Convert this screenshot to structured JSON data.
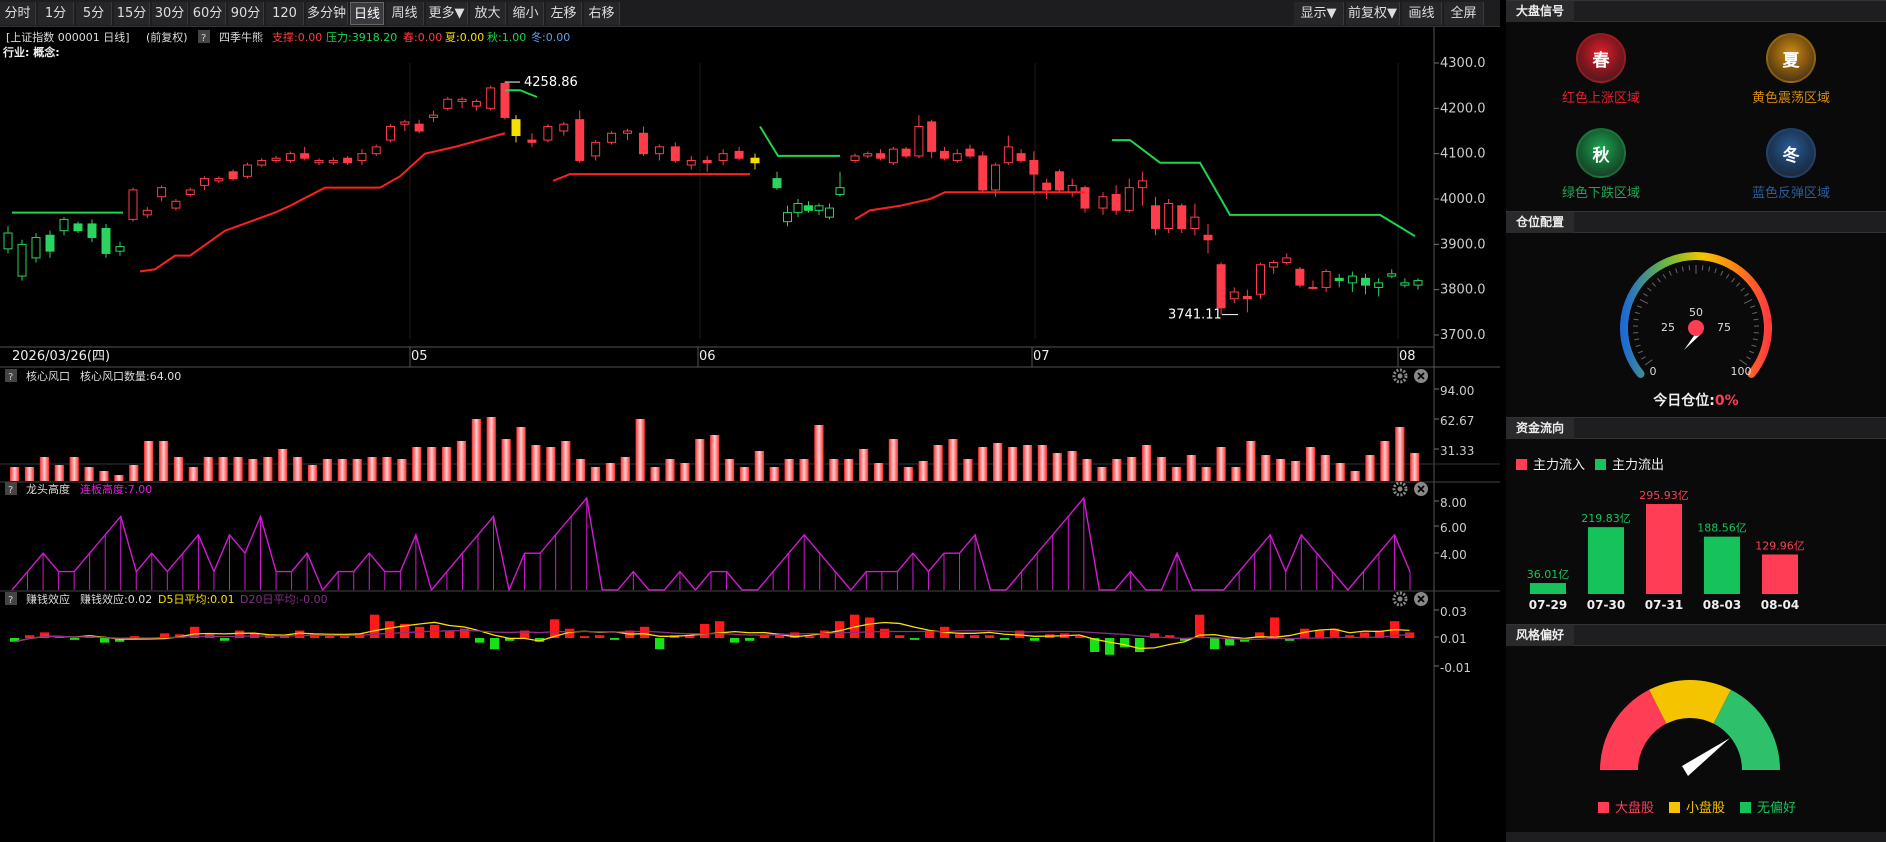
{
  "toolbar": {
    "periods": [
      "分时",
      "1分",
      "5分",
      "15分",
      "30分",
      "60分",
      "90分",
      "120分",
      "多分钟",
      "日线",
      "周线",
      "更多▼",
      "放大",
      "缩小",
      "左移",
      "右移"
    ],
    "active": "日线",
    "right_buttons": [
      "显示▼",
      "前复权▼",
      "画线",
      "全屏"
    ]
  },
  "header": {
    "title": "[上证指数 000001 日线]",
    "adjust": "(前复权)",
    "help": "?",
    "indicator": "四季牛熊",
    "support": "支撑:0.00",
    "pressure": "压力:3918.20",
    "spring": "春:0.00",
    "summer": "夏:0.00",
    "autumn": "秋:1.00",
    "winter": "冬:0.00",
    "sector": "行业: 概念:"
  },
  "main_axis": {
    "labels": [
      "4300.0",
      "4200.0",
      "4100.0",
      "4000.0",
      "3900.0",
      "3800.0",
      "3700.0"
    ]
  },
  "main_annot": {
    "high": "4258.86",
    "low": "3741.11"
  },
  "date_axis": {
    "start": "2026/03/26(四)",
    "months": [
      "05",
      "06",
      "07",
      "08"
    ]
  },
  "panels": {
    "p1": {
      "title": "核心风口",
      "value": "核心风口数量:64.00",
      "axis": [
        "94.00",
        "62.67",
        "31.33"
      ]
    },
    "p2": {
      "title": "龙头高度",
      "value": "连板高度:7.00",
      "axis": [
        "8.00",
        "6.00",
        "4.00"
      ]
    },
    "p3": {
      "title": "赚钱效应",
      "value": "赚钱效应:0.02",
      "d5": "D5日平均:0.01",
      "d20": "D20日平均:-0.00",
      "axis": [
        "0.03",
        "0.01",
        "-0.01"
      ]
    }
  },
  "chart_data": [
    {
      "type": "candlestick",
      "ylim": [
        3700,
        4300
      ],
      "high_label": 4258.86,
      "low_label": 3741.11,
      "candles": [
        [
          3890,
          3925,
          3880,
          3940
        ],
        [
          3830,
          3900,
          3820,
          3910
        ],
        [
          3870,
          3915,
          3860,
          3925
        ],
        [
          3920,
          3885,
          3870,
          3930
        ],
        [
          3930,
          3955,
          3920,
          3960
        ],
        [
          3945,
          3930,
          3925,
          3950
        ],
        [
          3945,
          3915,
          3905,
          3955
        ],
        [
          3935,
          3880,
          3870,
          3945
        ],
        [
          3885,
          3895,
          3875,
          3905
        ],
        [
          3955,
          4020,
          3950,
          4025
        ],
        [
          3965,
          3975,
          3958,
          3982
        ],
        [
          4005,
          4025,
          3995,
          4030
        ],
        [
          3980,
          3995,
          3975,
          4000
        ],
        [
          4010,
          4020,
          4005,
          4025
        ],
        [
          4030,
          4045,
          4020,
          4050
        ],
        [
          4040,
          4045,
          4035,
          4050
        ],
        [
          4060,
          4045,
          4040,
          4065
        ],
        [
          4050,
          4075,
          4045,
          4080
        ],
        [
          4075,
          4085,
          4070,
          4090
        ],
        [
          4085,
          4090,
          4080,
          4095
        ],
        [
          4085,
          4100,
          4080,
          4105
        ],
        [
          4100,
          4090,
          4085,
          4115
        ],
        [
          4080,
          4085,
          4075,
          4090
        ],
        [
          4080,
          4085,
          4075,
          4092
        ],
        [
          4090,
          4080,
          4075,
          4095
        ],
        [
          4085,
          4100,
          4075,
          4110
        ],
        [
          4100,
          4115,
          4095,
          4120
        ],
        [
          4130,
          4160,
          4125,
          4165
        ],
        [
          4165,
          4170,
          4150,
          4175
        ],
        [
          4165,
          4150,
          4145,
          4175
        ],
        [
          4180,
          4185,
          4170,
          4195
        ],
        [
          4200,
          4220,
          4195,
          4225
        ],
        [
          4215,
          4220,
          4200,
          4225
        ],
        [
          4205,
          4215,
          4195,
          4220
        ],
        [
          4200,
          4245,
          4195,
          4250
        ],
        [
          4255,
          4180,
          4175,
          4259
        ],
        [
          4175,
          4140,
          4125,
          4185
        ],
        [
          4130,
          4125,
          4115,
          4145
        ],
        [
          4130,
          4160,
          4125,
          4165
        ],
        [
          4150,
          4165,
          4140,
          4170
        ],
        [
          4175,
          4085,
          4080,
          4195
        ],
        [
          4095,
          4125,
          4085,
          4130
        ],
        [
          4125,
          4145,
          4120,
          4150
        ],
        [
          4145,
          4150,
          4130,
          4155
        ],
        [
          4145,
          4100,
          4095,
          4160
        ],
        [
          4100,
          4115,
          4085,
          4120
        ],
        [
          4115,
          4085,
          4080,
          4125
        ],
        [
          4075,
          4085,
          4065,
          4095
        ],
        [
          4085,
          4080,
          4060,
          4095
        ],
        [
          4085,
          4100,
          4075,
          4110
        ],
        [
          4105,
          4090,
          4085,
          4115
        ],
        [
          4090,
          4080,
          4065,
          4100
        ],
        [
          4045,
          4025,
          4020,
          4060
        ],
        [
          3950,
          3970,
          3940,
          3985
        ],
        [
          3970,
          3990,
          3960,
          4000
        ],
        [
          3985,
          3975,
          3970,
          3995
        ],
        [
          3975,
          3985,
          3965,
          3990
        ],
        [
          3960,
          3980,
          3955,
          3990
        ],
        [
          4010,
          4025,
          4005,
          4060
        ],
        [
          4085,
          4095,
          4080,
          4100
        ],
        [
          4095,
          4100,
          4090,
          4105
        ],
        [
          4100,
          4090,
          4085,
          4110
        ],
        [
          4080,
          4110,
          4075,
          4115
        ],
        [
          4110,
          4095,
          4090,
          4115
        ],
        [
          4095,
          4160,
          4090,
          4185
        ],
        [
          4170,
          4105,
          4090,
          4175
        ],
        [
          4105,
          4090,
          4085,
          4115
        ],
        [
          4085,
          4100,
          4080,
          4110
        ],
        [
          4110,
          4095,
          4090,
          4120
        ],
        [
          4095,
          4020,
          4015,
          4105
        ],
        [
          4020,
          4075,
          4005,
          4080
        ],
        [
          4080,
          4115,
          4075,
          4140
        ],
        [
          4100,
          4085,
          4080,
          4110
        ],
        [
          4085,
          4055,
          4010,
          4105
        ],
        [
          4035,
          4020,
          4000,
          4045
        ],
        [
          4060,
          4020,
          4015,
          4065
        ],
        [
          4015,
          4030,
          4005,
          4045
        ],
        [
          4025,
          3980,
          3970,
          4030
        ],
        [
          3980,
          4005,
          3965,
          4015
        ],
        [
          4010,
          3975,
          3965,
          4030
        ],
        [
          3975,
          4025,
          3970,
          4045
        ],
        [
          4025,
          4040,
          3985,
          4060
        ],
        [
          3985,
          3935,
          3920,
          4005
        ],
        [
          3935,
          3990,
          3925,
          4000
        ],
        [
          3985,
          3935,
          3925,
          3990
        ],
        [
          3935,
          3960,
          3920,
          3990
        ],
        [
          3920,
          3910,
          3880,
          3945
        ],
        [
          3855,
          3760,
          3745,
          3860
        ],
        [
          3780,
          3795,
          3770,
          3805
        ],
        [
          3785,
          3780,
          3750,
          3800
        ],
        [
          3790,
          3855,
          3780,
          3860
        ],
        [
          3850,
          3860,
          3835,
          3865
        ],
        [
          3860,
          3870,
          3855,
          3880
        ],
        [
          3845,
          3810,
          3805,
          3850
        ],
        [
          3805,
          3805,
          3800,
          3820
        ],
        [
          3805,
          3840,
          3795,
          3845
        ],
        [
          3825,
          3820,
          3805,
          3835
        ],
        [
          3815,
          3830,
          3795,
          3840
        ],
        [
          3825,
          3810,
          3790,
          3835
        ],
        [
          3805,
          3815,
          3785,
          3825
        ],
        [
          3830,
          3835,
          3825,
          3845
        ],
        [
          3810,
          3815,
          3805,
          3825
        ],
        [
          3810,
          3820,
          3800,
          3825
        ]
      ]
    },
    {
      "type": "bar",
      "title": "核心风口",
      "ylim": [
        0,
        94
      ],
      "values": [
        14,
        14,
        24,
        16,
        24,
        14,
        10,
        6,
        16,
        40,
        40,
        24,
        14,
        24,
        24,
        24,
        22,
        24,
        32,
        24,
        16,
        22,
        22,
        22,
        24,
        24,
        22,
        34,
        34,
        34,
        40,
        62,
        64,
        42,
        54,
        36,
        34,
        40,
        22,
        14,
        18,
        24,
        62,
        14,
        22,
        18,
        42,
        46,
        22,
        14,
        30,
        14,
        22,
        22,
        56,
        22,
        22,
        32,
        18,
        42,
        14,
        20,
        36,
        42,
        22,
        34,
        38,
        34,
        36,
        36,
        28,
        30,
        22,
        14,
        22,
        24,
        36,
        24,
        14,
        26,
        14,
        34,
        14,
        40,
        26,
        22,
        20,
        34,
        26,
        18,
        10,
        26,
        40,
        54,
        28
      ],
      "total": 64
    },
    {
      "type": "line",
      "title": "龙头高度",
      "ylim": [
        3,
        8
      ],
      "values": [
        3,
        4,
        5,
        4,
        4,
        5,
        6,
        7,
        4,
        5,
        4,
        5,
        6,
        4,
        6,
        5,
        7,
        4,
        4,
        5,
        3,
        4,
        4,
        5,
        4,
        4,
        6,
        3,
        4,
        5,
        6,
        7,
        3,
        5,
        5,
        6,
        7,
        8,
        3,
        3,
        4,
        3,
        3,
        4,
        3,
        4,
        4,
        3,
        3,
        4,
        5,
        6,
        5,
        4,
        3,
        4,
        4,
        4,
        5,
        4,
        5,
        5,
        6,
        3,
        3,
        4,
        5,
        6,
        7,
        8,
        3,
        3,
        4,
        3,
        3,
        5,
        3,
        3,
        3,
        4,
        5,
        6,
        4,
        6,
        5,
        4,
        3,
        4,
        5,
        6,
        4
      ]
    },
    {
      "type": "bar",
      "title": "赚钱效应",
      "ylim": [
        -0.02,
        0.035
      ],
      "values": [
        -0.004,
        0.003,
        0.006,
        0.002,
        -0.002,
        0.003,
        -0.005,
        -0.004,
        0.002,
        -0.001,
        0.005,
        0.004,
        0.012,
        0.004,
        -0.003,
        0.008,
        0.005,
        0.003,
        0.002,
        0.008,
        0.004,
        0.003,
        0.002,
        0.005,
        0.025,
        0.018,
        0.015,
        0.012,
        0.014,
        0.008,
        0.01,
        -0.005,
        -0.012,
        -0.003,
        0.008,
        -0.004,
        0.02,
        0.01,
        0.002,
        0.003,
        -0.002,
        0.008,
        0.012,
        -0.012,
        0.003,
        0.003,
        0.015,
        0.018,
        -0.005,
        -0.003,
        0.004,
        0.005,
        0.006,
        0.002,
        0.008,
        0.018,
        0.025,
        0.022,
        0.01,
        0.003,
        -0.002,
        0.008,
        0.012,
        0.004,
        0.003,
        0.003,
        -0.002,
        0.008,
        -0.003,
        0.004,
        0.005,
        0.002,
        -0.015,
        -0.018,
        -0.01,
        -0.015,
        0.005,
        0.003,
        -0.003,
        0.025,
        -0.012,
        -0.008,
        -0.004,
        0.006,
        0.022,
        -0.003,
        0.01,
        0.008,
        0.01,
        0.003,
        0.006,
        0.008,
        0.018,
        0.006
      ]
    },
    {
      "type": "bar",
      "title": "资金流向",
      "categories": [
        "07-29",
        "07-30",
        "07-31",
        "08-03",
        "08-04"
      ],
      "values": [
        36.01,
        219.83,
        295.93,
        188.56,
        129.96
      ],
      "labels": [
        "36.01亿",
        "219.83亿",
        "295.93亿",
        "188.56亿",
        "129.96亿"
      ],
      "directions": [
        "out",
        "out",
        "in",
        "out",
        "in"
      ]
    }
  ],
  "right": {
    "signals_title": "大盘信号",
    "signals": [
      {
        "char": "春",
        "label": "红色上涨区域",
        "color": "#e0202e"
      },
      {
        "char": "夏",
        "label": "黄色震荡区域",
        "color": "#d38b14"
      },
      {
        "char": "秋",
        "label": "绿色下跌区域",
        "color": "#1fa652"
      },
      {
        "char": "冬",
        "label": "蓝色反弹区域",
        "color": "#2a5d9a"
      }
    ],
    "position_title": "仓位配置",
    "gauge_labels": [
      "0",
      "25",
      "50",
      "75",
      "100"
    ],
    "position_label": "今日仓位:",
    "position_value": "0%",
    "flow_title": "资金流向",
    "flow_legend_in": "主力流入",
    "flow_legend_out": "主力流出",
    "style_title": "风格偏好",
    "style_legend": [
      "大盘股",
      "小盘股",
      "无偏好"
    ],
    "colors": {
      "red": "#ff3d55",
      "green": "#16c35b",
      "yellow": "#f5c400"
    }
  }
}
